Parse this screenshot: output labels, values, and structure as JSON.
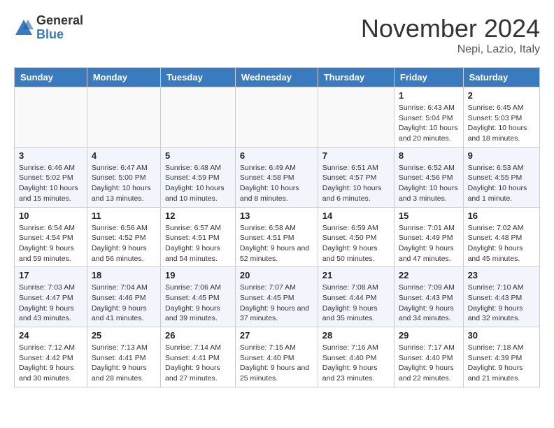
{
  "logo": {
    "general": "General",
    "blue": "Blue"
  },
  "title": "November 2024",
  "location": "Nepi, Lazio, Italy",
  "days_of_week": [
    "Sunday",
    "Monday",
    "Tuesday",
    "Wednesday",
    "Thursday",
    "Friday",
    "Saturday"
  ],
  "weeks": [
    [
      {
        "day": "",
        "info": ""
      },
      {
        "day": "",
        "info": ""
      },
      {
        "day": "",
        "info": ""
      },
      {
        "day": "",
        "info": ""
      },
      {
        "day": "",
        "info": ""
      },
      {
        "day": "1",
        "info": "Sunrise: 6:43 AM\nSunset: 5:04 PM\nDaylight: 10 hours and 20 minutes."
      },
      {
        "day": "2",
        "info": "Sunrise: 6:45 AM\nSunset: 5:03 PM\nDaylight: 10 hours and 18 minutes."
      }
    ],
    [
      {
        "day": "3",
        "info": "Sunrise: 6:46 AM\nSunset: 5:02 PM\nDaylight: 10 hours and 15 minutes."
      },
      {
        "day": "4",
        "info": "Sunrise: 6:47 AM\nSunset: 5:00 PM\nDaylight: 10 hours and 13 minutes."
      },
      {
        "day": "5",
        "info": "Sunrise: 6:48 AM\nSunset: 4:59 PM\nDaylight: 10 hours and 10 minutes."
      },
      {
        "day": "6",
        "info": "Sunrise: 6:49 AM\nSunset: 4:58 PM\nDaylight: 10 hours and 8 minutes."
      },
      {
        "day": "7",
        "info": "Sunrise: 6:51 AM\nSunset: 4:57 PM\nDaylight: 10 hours and 6 minutes."
      },
      {
        "day": "8",
        "info": "Sunrise: 6:52 AM\nSunset: 4:56 PM\nDaylight: 10 hours and 3 minutes."
      },
      {
        "day": "9",
        "info": "Sunrise: 6:53 AM\nSunset: 4:55 PM\nDaylight: 10 hours and 1 minute."
      }
    ],
    [
      {
        "day": "10",
        "info": "Sunrise: 6:54 AM\nSunset: 4:54 PM\nDaylight: 9 hours and 59 minutes."
      },
      {
        "day": "11",
        "info": "Sunrise: 6:56 AM\nSunset: 4:52 PM\nDaylight: 9 hours and 56 minutes."
      },
      {
        "day": "12",
        "info": "Sunrise: 6:57 AM\nSunset: 4:51 PM\nDaylight: 9 hours and 54 minutes."
      },
      {
        "day": "13",
        "info": "Sunrise: 6:58 AM\nSunset: 4:51 PM\nDaylight: 9 hours and 52 minutes."
      },
      {
        "day": "14",
        "info": "Sunrise: 6:59 AM\nSunset: 4:50 PM\nDaylight: 9 hours and 50 minutes."
      },
      {
        "day": "15",
        "info": "Sunrise: 7:01 AM\nSunset: 4:49 PM\nDaylight: 9 hours and 47 minutes."
      },
      {
        "day": "16",
        "info": "Sunrise: 7:02 AM\nSunset: 4:48 PM\nDaylight: 9 hours and 45 minutes."
      }
    ],
    [
      {
        "day": "17",
        "info": "Sunrise: 7:03 AM\nSunset: 4:47 PM\nDaylight: 9 hours and 43 minutes."
      },
      {
        "day": "18",
        "info": "Sunrise: 7:04 AM\nSunset: 4:46 PM\nDaylight: 9 hours and 41 minutes."
      },
      {
        "day": "19",
        "info": "Sunrise: 7:06 AM\nSunset: 4:45 PM\nDaylight: 9 hours and 39 minutes."
      },
      {
        "day": "20",
        "info": "Sunrise: 7:07 AM\nSunset: 4:45 PM\nDaylight: 9 hours and 37 minutes."
      },
      {
        "day": "21",
        "info": "Sunrise: 7:08 AM\nSunset: 4:44 PM\nDaylight: 9 hours and 35 minutes."
      },
      {
        "day": "22",
        "info": "Sunrise: 7:09 AM\nSunset: 4:43 PM\nDaylight: 9 hours and 34 minutes."
      },
      {
        "day": "23",
        "info": "Sunrise: 7:10 AM\nSunset: 4:43 PM\nDaylight: 9 hours and 32 minutes."
      }
    ],
    [
      {
        "day": "24",
        "info": "Sunrise: 7:12 AM\nSunset: 4:42 PM\nDaylight: 9 hours and 30 minutes."
      },
      {
        "day": "25",
        "info": "Sunrise: 7:13 AM\nSunset: 4:41 PM\nDaylight: 9 hours and 28 minutes."
      },
      {
        "day": "26",
        "info": "Sunrise: 7:14 AM\nSunset: 4:41 PM\nDaylight: 9 hours and 27 minutes."
      },
      {
        "day": "27",
        "info": "Sunrise: 7:15 AM\nSunset: 4:40 PM\nDaylight: 9 hours and 25 minutes."
      },
      {
        "day": "28",
        "info": "Sunrise: 7:16 AM\nSunset: 4:40 PM\nDaylight: 9 hours and 23 minutes."
      },
      {
        "day": "29",
        "info": "Sunrise: 7:17 AM\nSunset: 4:40 PM\nDaylight: 9 hours and 22 minutes."
      },
      {
        "day": "30",
        "info": "Sunrise: 7:18 AM\nSunset: 4:39 PM\nDaylight: 9 hours and 21 minutes."
      }
    ]
  ]
}
